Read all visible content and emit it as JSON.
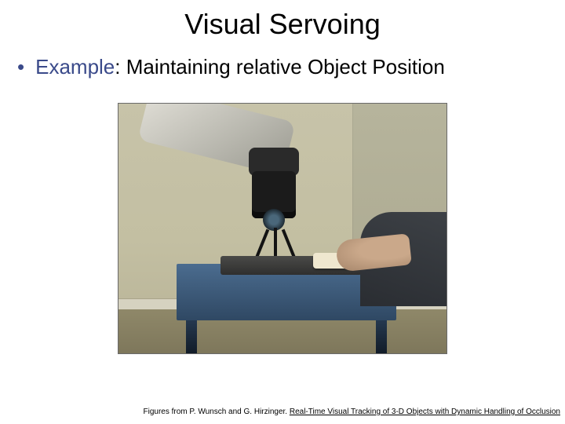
{
  "title": "Visual Servoing",
  "bullet": {
    "label": "Example",
    "separator": ": ",
    "text": "Maintaining relative Object Position"
  },
  "caption": {
    "prefix": "Figures from P. Wunsch and G. Hirzinger. ",
    "link": "Real-Time Visual Tracking of 3-D Objects with Dynamic Handling of Occlusion"
  }
}
